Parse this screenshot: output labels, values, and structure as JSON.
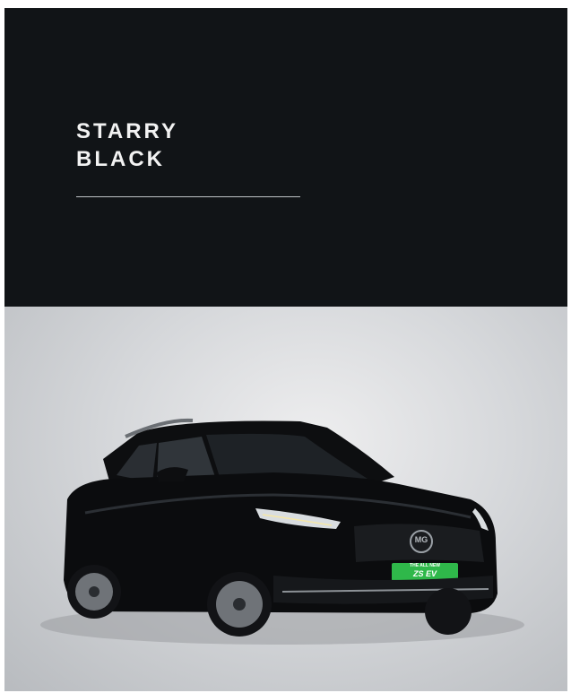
{
  "heading": {
    "line1": "STARRY",
    "line2": "BLACK"
  },
  "car": {
    "badge_line1": "THE ALL NEW",
    "badge_line2": "ZS EV",
    "grille_logo": "MG",
    "body_color": "#0b0c0e",
    "badge_color": "#2fb84a"
  }
}
